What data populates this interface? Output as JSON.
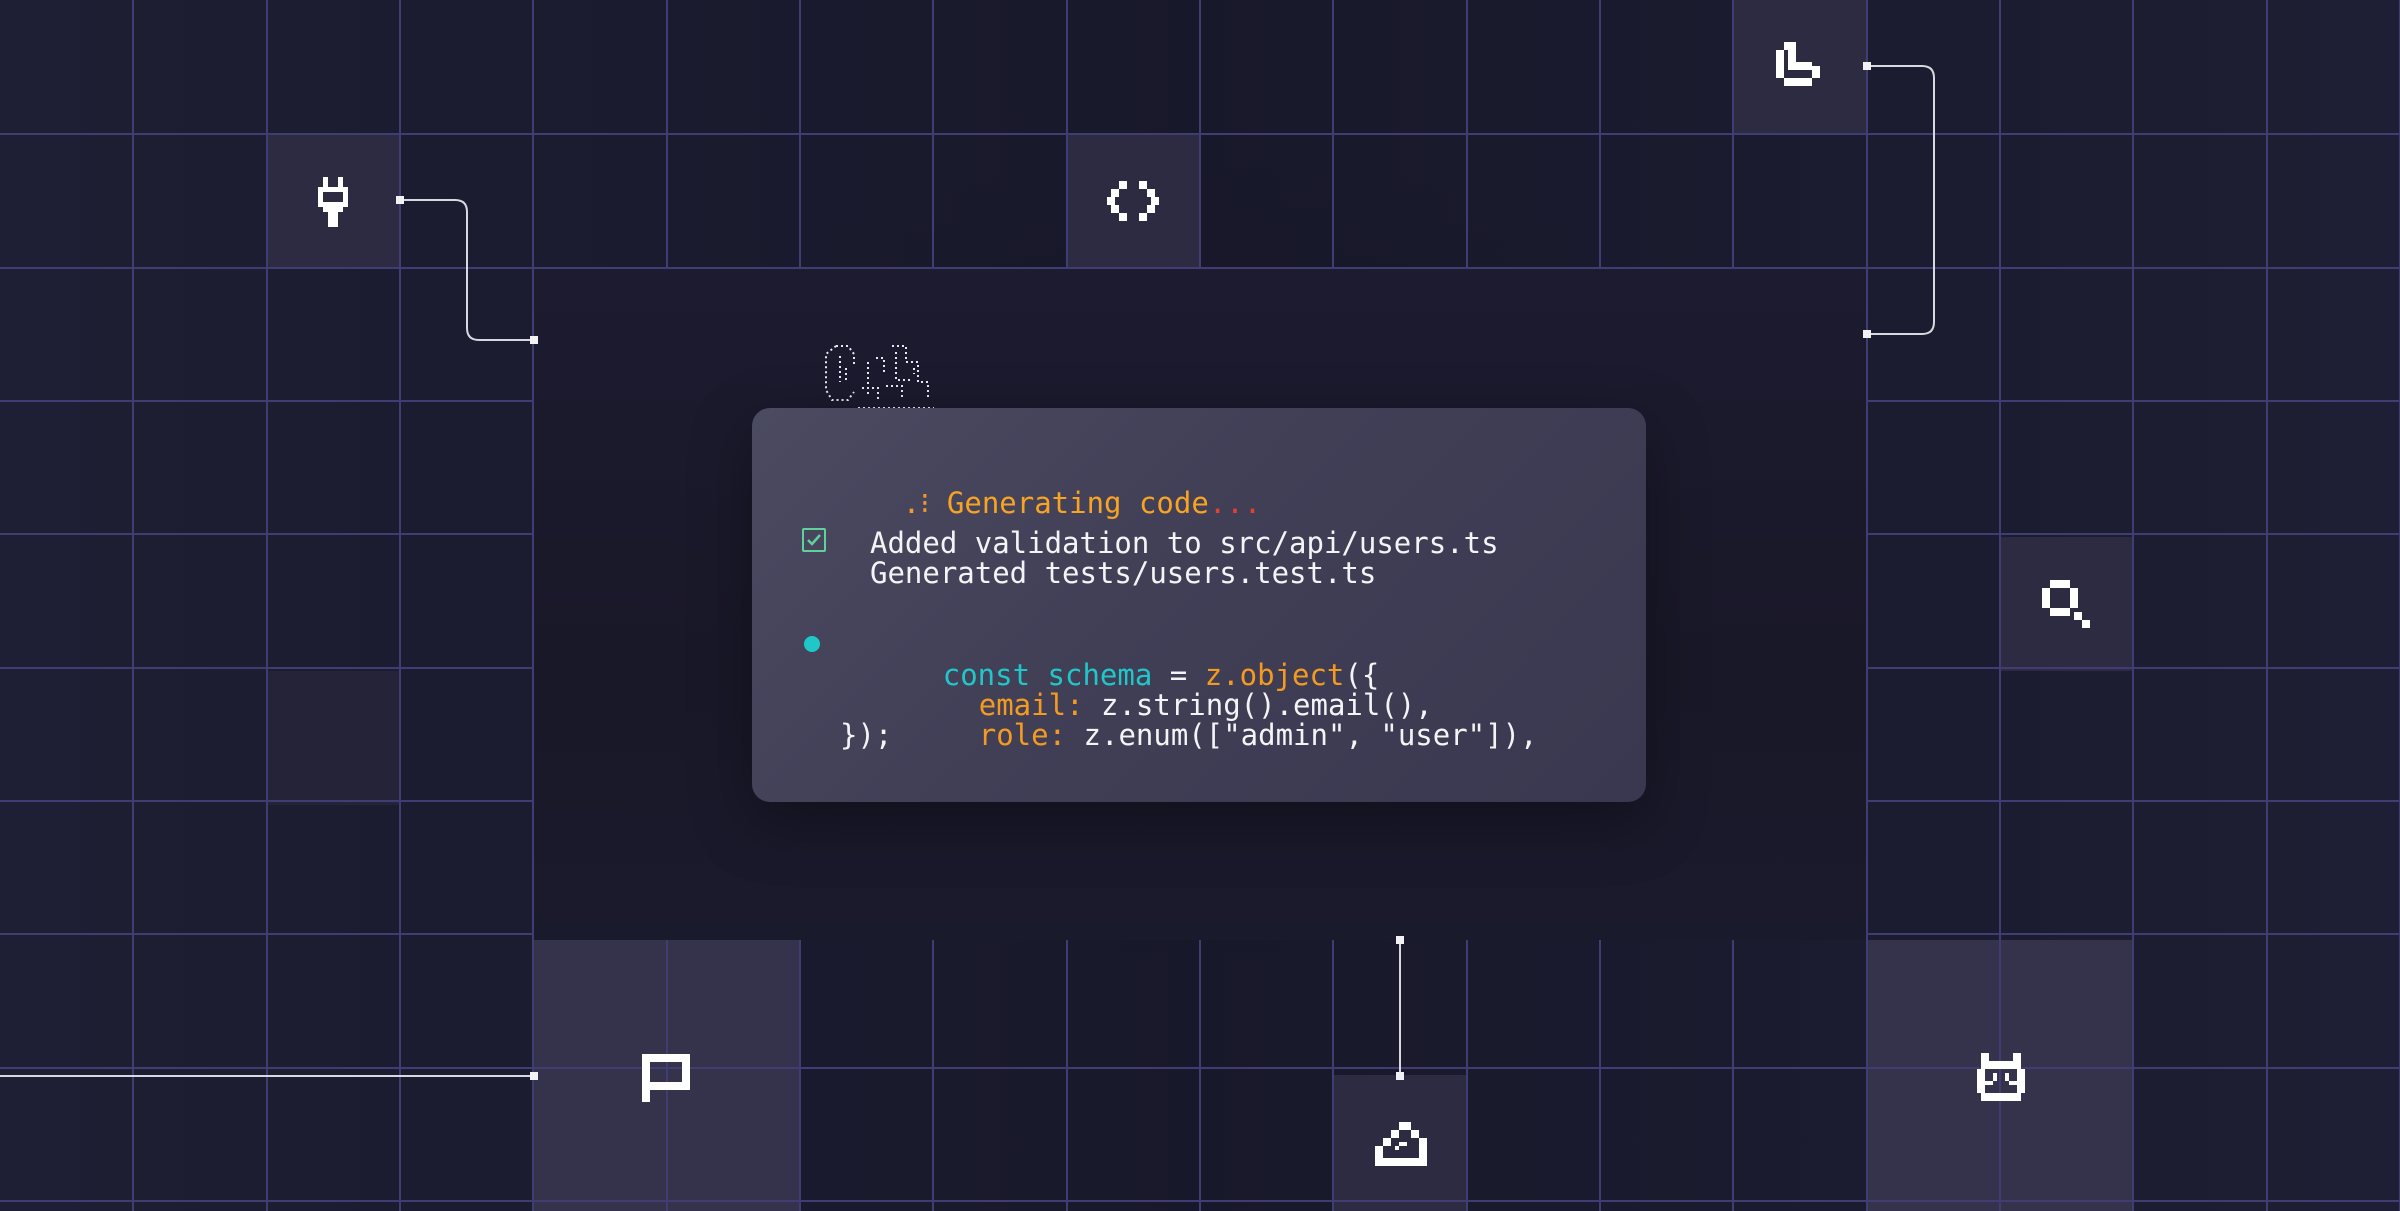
{
  "terminal": {
    "status_mark": ".⁝",
    "status_text": "Generating code",
    "status_ellipsis": "...",
    "change_lines": [
      "Added validation to src/api/users.ts",
      "Generated tests/users.test.ts"
    ],
    "code": {
      "line1": {
        "keyword": "const",
        "identifier": "schema",
        "op": "=",
        "call": "z.object",
        "open": "({"
      },
      "line2": {
        "key": "email:",
        "value": "z.string().email(),"
      },
      "line3": {
        "key": "role:",
        "value": "z.enum([\"admin\", \"user\"]),"
      },
      "line4": "});"
    }
  },
  "icons": {
    "top_left": "plug-icon",
    "top_center": "code-brackets-icon",
    "top_right": "pie-chart-icon",
    "right_middle": "search-icon",
    "bottom_left": "flag-icon",
    "bottom_center": "cloud-icon",
    "bottom_right": "robot-icon",
    "mascot": "claude-mascot-icon"
  },
  "colors": {
    "background": "#1b1b2e",
    "grid_line": "#3f3d73",
    "card": "#45445b",
    "accent_orange": "#f49a21",
    "accent_cyan": "#21c7c8",
    "accent_green": "#5fd19a",
    "accent_red": "#e2412f"
  }
}
